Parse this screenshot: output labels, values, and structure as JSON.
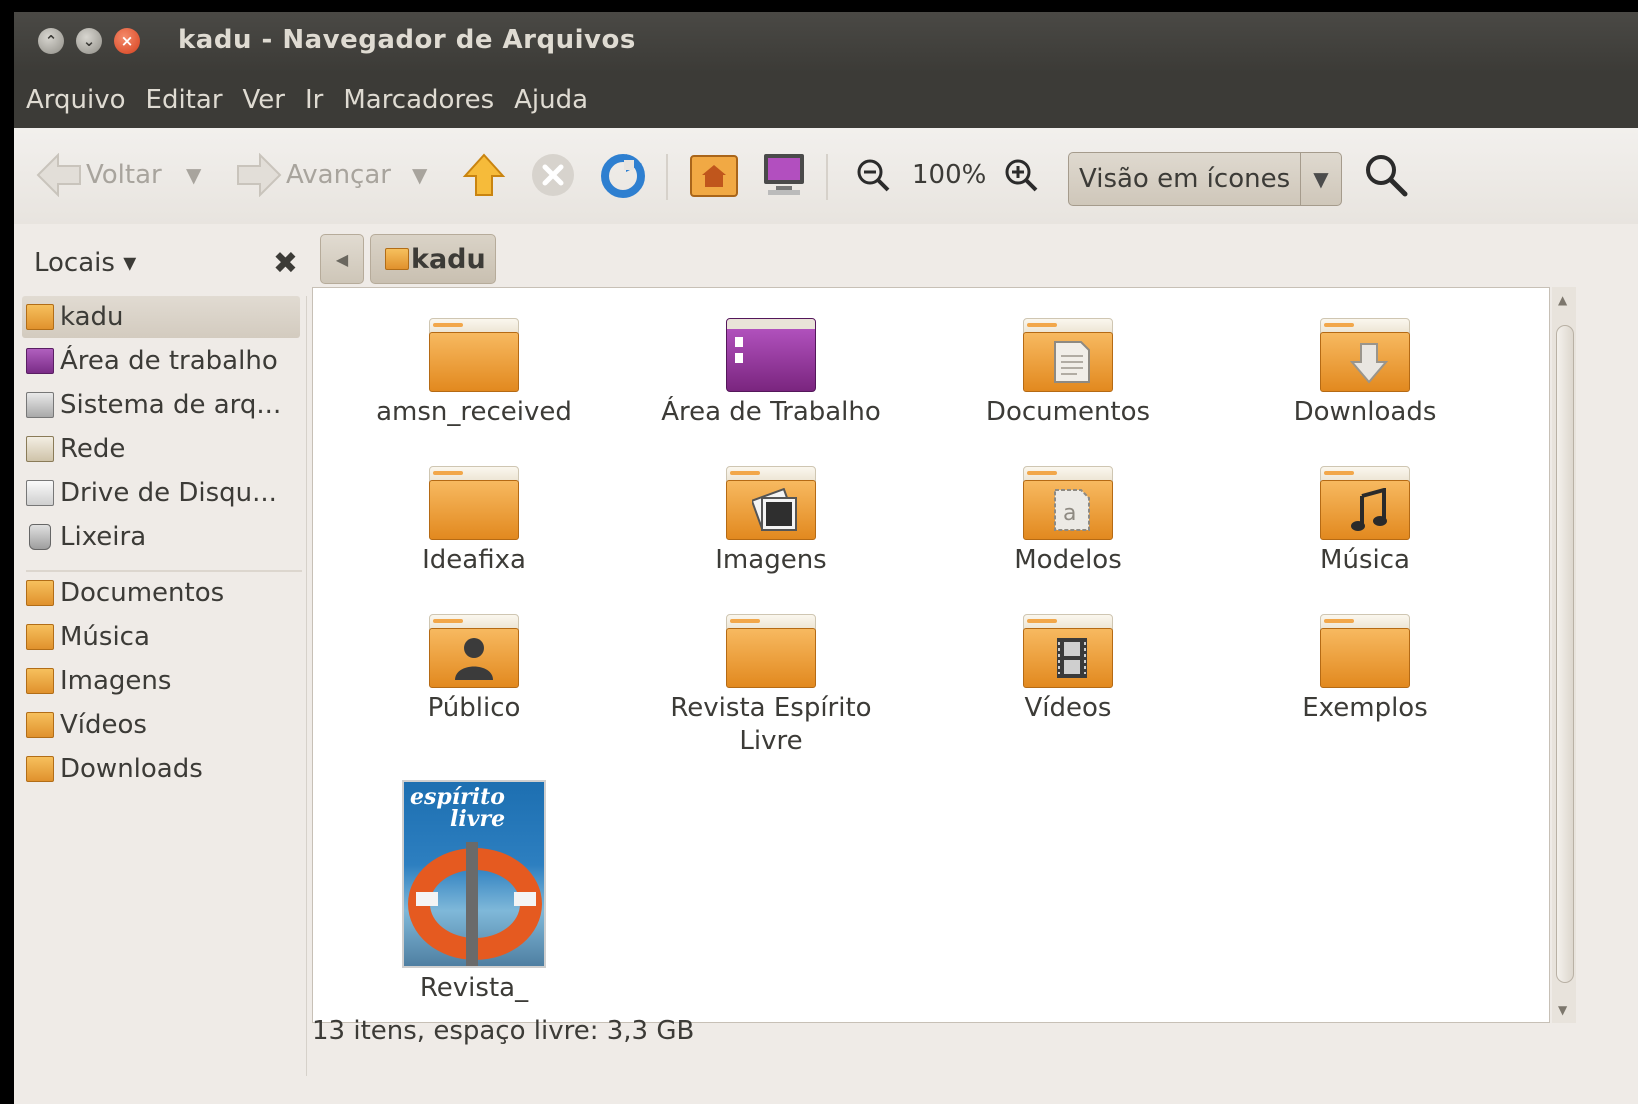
{
  "window": {
    "title": "kadu - Navegador de Arquivos"
  },
  "menubar": [
    "Arquivo",
    "Editar",
    "Ver",
    "Ir",
    "Marcadores",
    "Ajuda"
  ],
  "toolbar": {
    "back_label": "Voltar",
    "forward_label": "Avançar",
    "zoom_level": "100%",
    "view_mode": "Visão em ícones"
  },
  "sidebar": {
    "header": "Locais ▾",
    "places": [
      {
        "label": "kadu",
        "icon": "home-folder-icon",
        "selected": true
      },
      {
        "label": "Área de trabalho",
        "icon": "desktop-icon"
      },
      {
        "label": "Sistema de arq...",
        "icon": "drive-icon"
      },
      {
        "label": "Rede",
        "icon": "network-icon"
      },
      {
        "label": "Drive de Disqu...",
        "icon": "floppy-icon"
      },
      {
        "label": "Lixeira",
        "icon": "trash-icon"
      }
    ],
    "bookmarks": [
      {
        "label": "Documentos",
        "icon": "documents-folder-icon"
      },
      {
        "label": "Música",
        "icon": "music-folder-icon"
      },
      {
        "label": "Imagens",
        "icon": "pictures-folder-icon"
      },
      {
        "label": "Vídeos",
        "icon": "videos-folder-icon"
      },
      {
        "label": "Downloads",
        "icon": "downloads-folder-icon"
      }
    ]
  },
  "pathbar": {
    "current": "kadu"
  },
  "files": [
    {
      "label": "amsn_received",
      "type": "folder"
    },
    {
      "label": "Área de Trabalho",
      "type": "desktop"
    },
    {
      "label": "Documentos",
      "type": "folder",
      "emblem": "document"
    },
    {
      "label": "Downloads",
      "type": "folder",
      "emblem": "download"
    },
    {
      "label": "Ideafixa",
      "type": "folder"
    },
    {
      "label": "Imagens",
      "type": "folder",
      "emblem": "picture"
    },
    {
      "label": "Modelos",
      "type": "folder",
      "emblem": "template"
    },
    {
      "label": "Música",
      "type": "folder",
      "emblem": "music"
    },
    {
      "label": "Público",
      "type": "folder",
      "emblem": "person"
    },
    {
      "label": "Revista Espírito Livre",
      "type": "folder"
    },
    {
      "label": "Vídeos",
      "type": "folder",
      "emblem": "film"
    },
    {
      "label": "Exemplos",
      "type": "folder"
    },
    {
      "label": "Revista_",
      "type": "pdf-thumbnail",
      "cover_title_1": "espírito",
      "cover_title_2": "livre"
    }
  ],
  "status": "13 itens, espaço livre: 3,3 GB"
}
